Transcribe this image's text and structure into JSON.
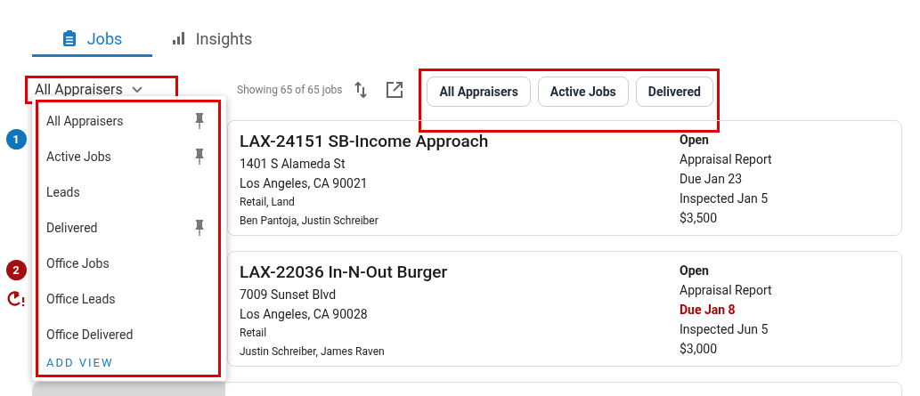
{
  "tabs": [
    {
      "label": "Jobs",
      "selected": true
    },
    {
      "label": "Insights",
      "selected": false
    }
  ],
  "view_selector": {
    "value": "All Appraisers",
    "highlighted": true,
    "expanded": true
  },
  "count_text": "Showing 65 of 65 jobs",
  "quick_views": {
    "highlighted": true,
    "chips": [
      "All Appraisers",
      "Active Jobs",
      "Delivered"
    ]
  },
  "view_menu": {
    "highlighted": true,
    "items": [
      {
        "label": "All Appraisers",
        "pinned": true
      },
      {
        "label": "Active Jobs",
        "pinned": true
      },
      {
        "label": "Leads",
        "pinned": false
      },
      {
        "label": "Delivered",
        "pinned": true
      },
      {
        "label": "Office Jobs",
        "pinned": false
      },
      {
        "label": "Office Leads",
        "pinned": false
      },
      {
        "label": "Office Delivered",
        "pinned": false
      }
    ],
    "add_label": "ADD VIEW"
  },
  "jobs": [
    {
      "badge": "1",
      "color": "#0f75bc",
      "alert": false,
      "title": "LAX-24151 SB-Income Approach",
      "address": "1401 S Alameda St",
      "city": "Los Angeles, CA 90021",
      "types": "Retail, Land",
      "appraisers": "Ben Pantoja, Justin Schreiber",
      "status": "Open",
      "report": "Appraisal Report",
      "due": "Due Jan 23",
      "overdue": false,
      "inspected": "Inspected Jan 5",
      "fee": "$3,500"
    },
    {
      "badge": "2",
      "color": "#a50e0e",
      "alert": true,
      "title": "LAX-22036 In-N-Out Burger",
      "address": "7009 Sunset Blvd",
      "city": "Los Angeles, CA 90028",
      "types": "Retail",
      "appraisers": "Justin Schreiber, James Raven",
      "status": "Open",
      "report": "Appraisal Report",
      "due": "Due Jan 8",
      "overdue": true,
      "inspected": "Inspected Jun 5",
      "fee": "$3,000"
    }
  ]
}
